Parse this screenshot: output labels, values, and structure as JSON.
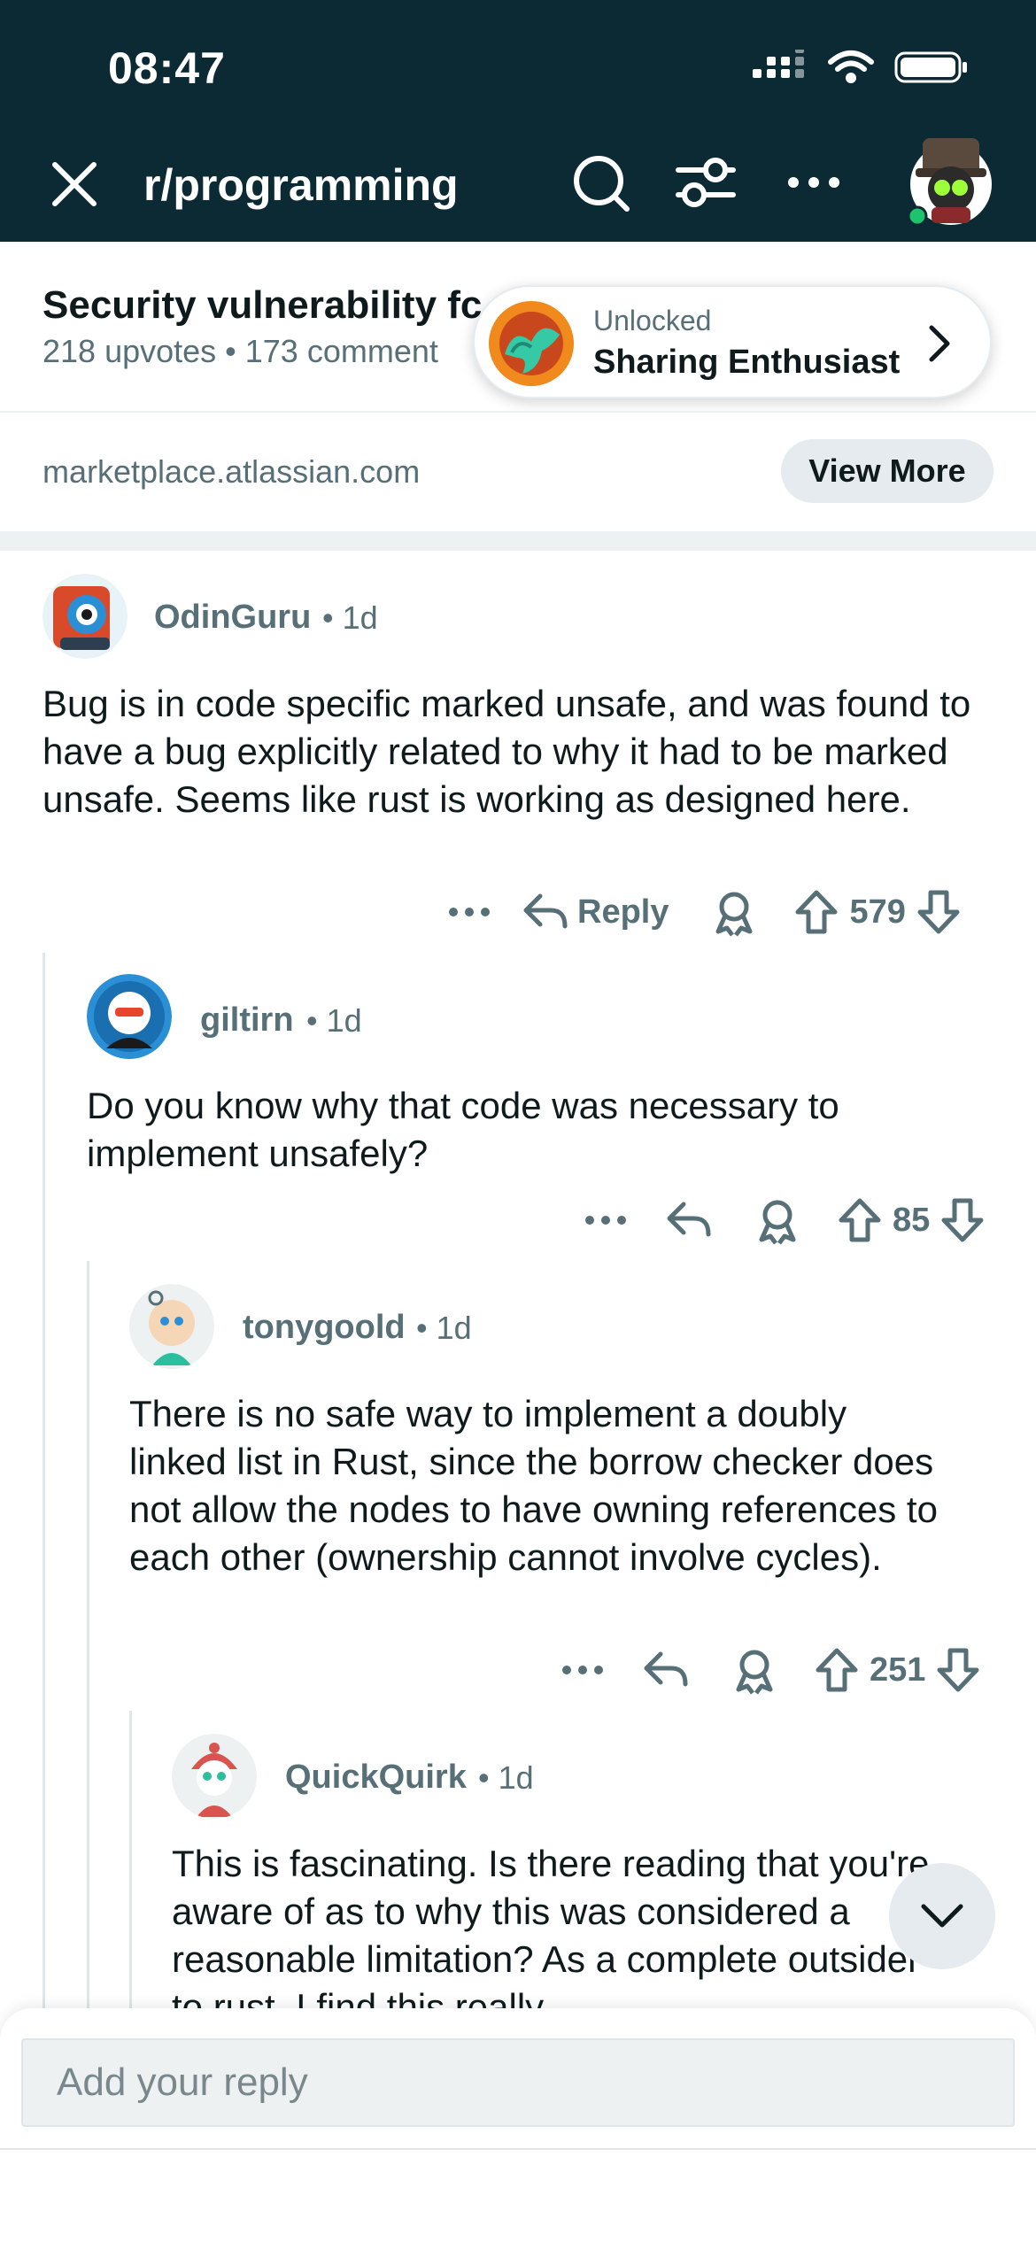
{
  "status_bar": {
    "time": "08:47"
  },
  "nav": {
    "title": "r/programming"
  },
  "post": {
    "title": "Security vulnerability fc",
    "meta": "218 upvotes • 173 comment",
    "link_domain": "marketplace.atlassian.com",
    "view_more_label": "View More"
  },
  "achievement": {
    "small": "Unlocked",
    "title": "Sharing Enthusiast"
  },
  "comments": [
    {
      "author": "OdinGuru",
      "time": "• 1d",
      "body": "Bug is in code specific marked unsafe, and was found to have a bug explicitly related to why it had to be marked unsafe. Seems like rust is working as designed here.",
      "reply_label": "Reply",
      "score": "579"
    },
    {
      "author": "giltirn",
      "time": "• 1d",
      "body": "Do you know why that code was necessary to implement unsafely?",
      "score": "85"
    },
    {
      "author": "tonygoold",
      "time": "• 1d",
      "body": "There is no safe way to implement a doubly linked list in Rust, since the borrow checker does not allow the nodes to have owning references to each other (ownership cannot involve cycles).",
      "score": "251"
    },
    {
      "author": "QuickQuirk",
      "time": "• 1d",
      "body": "This is fascinating. Is there reading that you're aware of as to why this was considered a reasonable limitation? As a complete outsider to rust, I find this really"
    }
  ],
  "reply_bar": {
    "placeholder": "Add your reply"
  },
  "colors": {
    "header_bg": "#0b2a33",
    "meta_text": "#576f76",
    "chip_bg": "#e5ebee"
  }
}
